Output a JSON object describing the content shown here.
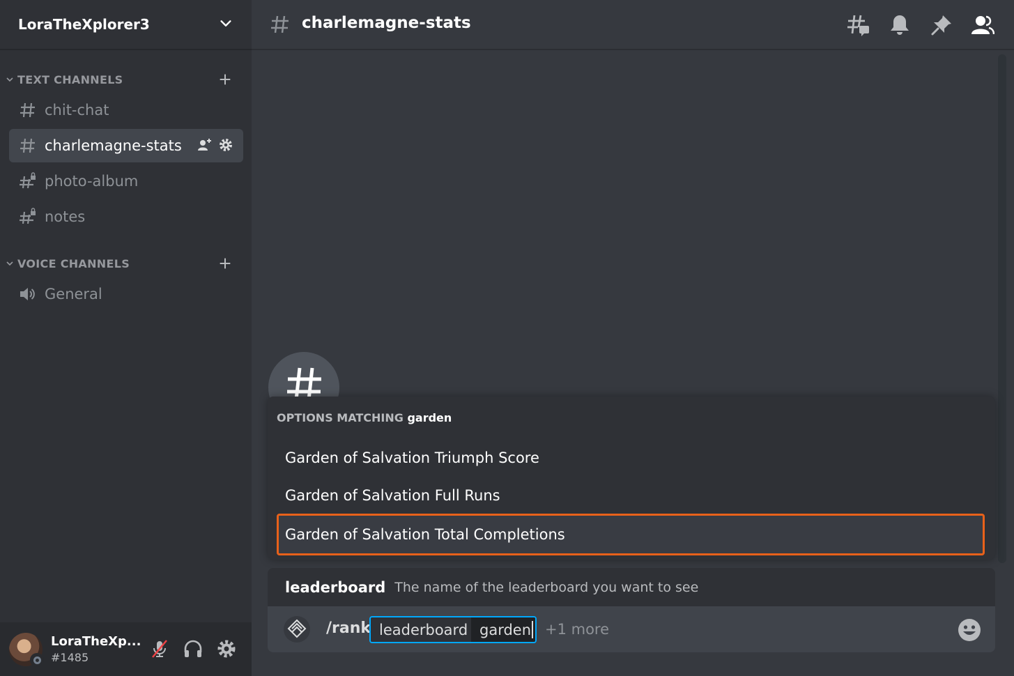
{
  "server": {
    "name": "LoraTheXplorer3"
  },
  "categories": [
    {
      "label": "TEXT CHANNELS"
    },
    {
      "label": "VOICE CHANNELS"
    }
  ],
  "channels": [
    {
      "label": "chit-chat"
    },
    {
      "label": "charlemagne-stats"
    },
    {
      "label": "photo-album"
    },
    {
      "label": "notes"
    },
    {
      "label": "General"
    }
  ],
  "user": {
    "name": "LoraTheXp...",
    "tag": "#1485"
  },
  "topbar": {
    "title": "charlemagne-stats"
  },
  "autocomplete": {
    "heading_prefix": "OPTIONS MATCHING",
    "query": "garden",
    "options": [
      {
        "label": "Garden of Salvation Triumph Score"
      },
      {
        "label": "Garden of Salvation Full Runs"
      },
      {
        "label": "Garden of Salvation Total Completions"
      }
    ]
  },
  "hint": {
    "name": "leaderboard",
    "description": "The name of the leaderboard you want to see"
  },
  "composer": {
    "command": "/rank",
    "option_name": "leaderboard",
    "option_value": "garden",
    "more": "+1 more"
  },
  "colors": {
    "selection_outline": "#e8611a",
    "input_focus": "#00a8fc"
  }
}
